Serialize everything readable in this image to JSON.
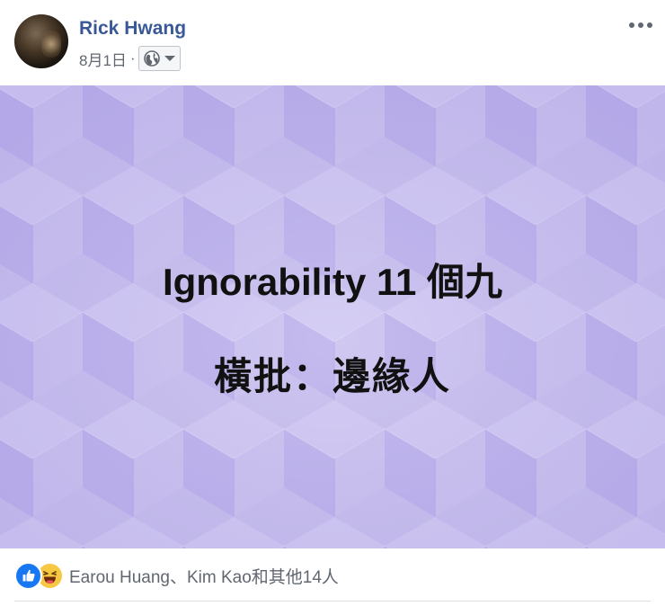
{
  "post": {
    "author_name": "Rick Hwang",
    "date": "8月1日",
    "separator": "·",
    "privacy_icon": "globe-icon",
    "more_icon": "more-options-icon"
  },
  "image": {
    "line1": "Ignorability 11 個九",
    "line2": "橫批：邊緣人",
    "background_color": "#c3b9ec"
  },
  "reactions": {
    "icons": [
      "like-icon",
      "haha-icon"
    ],
    "summary": "Earou Huang、Kim Kao和其他14人"
  },
  "colors": {
    "author": "#385898",
    "meta": "#616770",
    "like": "#1877f2",
    "haha": "#f7c843"
  }
}
